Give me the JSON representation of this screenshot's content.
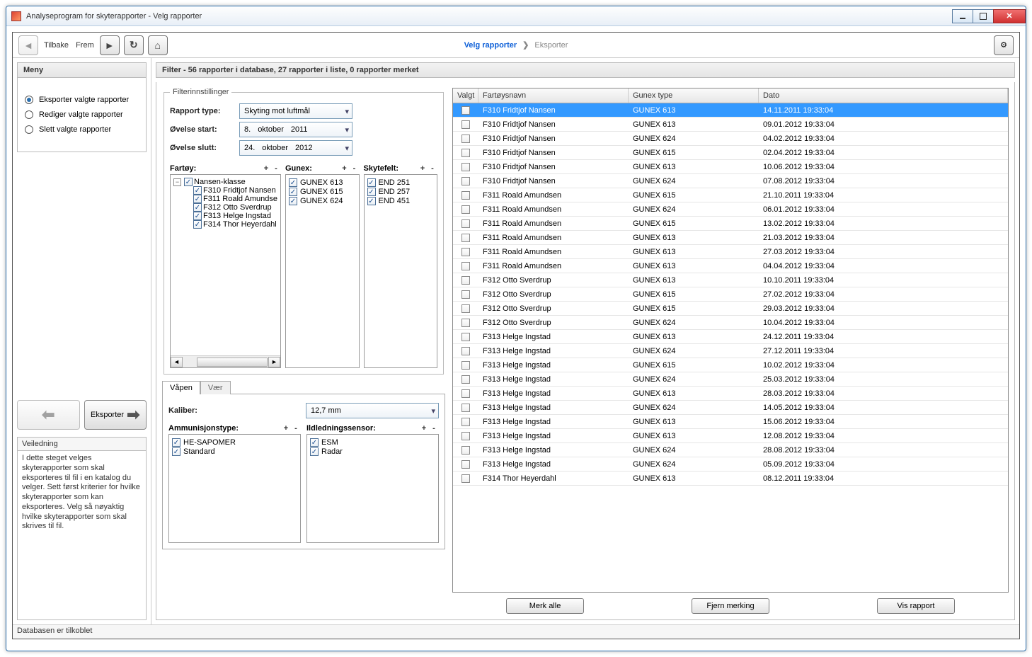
{
  "window_title": "Analyseprogram for skyterapporter - Velg rapporter",
  "toolbar": {
    "back": "Tilbake",
    "forward": "Frem"
  },
  "breadcrumb": {
    "step1": "Velg rapporter",
    "step2": "Eksporter"
  },
  "menu": {
    "title": "Meny",
    "options": [
      {
        "label": "Eksporter valgte rapporter",
        "checked": true
      },
      {
        "label": "Rediger valgte rapporter",
        "checked": false
      },
      {
        "label": "Slett valgte rapporter",
        "checked": false
      }
    ],
    "export_btn": "Eksporter"
  },
  "guide": {
    "title": "Veiledning",
    "text": "I dette steget velges skyterapporter som skal eksporteres til fil i en katalog du velger. Sett først kriterier for hvilke skyterapporter som kan eksporteres. Velg så nøyaktig hvilke skyterapporter som skal skrives til fil."
  },
  "filter": {
    "title": "Filter - 56 rapporter i database, 27 rapporter i liste, 0 rapporter merket",
    "legend": "Filterinnstillinger",
    "rows": {
      "type_label": "Rapport type:",
      "type_value": "Skyting mot luftmål",
      "start_label": "Øvelse start:",
      "start_d": "8.",
      "start_m": "oktober",
      "start_y": "2011",
      "slutt_label": "Øvelse slutt:",
      "slutt_d": "24.",
      "slutt_m": "oktober",
      "slutt_y": "2012"
    },
    "cols": {
      "fartoy": "Fartøy:",
      "gunex": "Gunex:",
      "skytefelt": "Skytefelt:"
    },
    "fartoy_tree": {
      "root": "Nansen-klasse",
      "children": [
        "F310 Fridtjof Nansen",
        "F311 Roald Amundse",
        "F312 Otto Sverdrup",
        "F313 Helge Ingstad",
        "F314 Thor Heyerdahl"
      ]
    },
    "gunex_items": [
      "GUNEX 613",
      "GUNEX 615",
      "GUNEX 624"
    ],
    "skytefelt_items": [
      "END 251",
      "END 257",
      "END 451"
    ],
    "tabs": {
      "vaapen": "Våpen",
      "vaer": "Vær"
    },
    "kaliber_label": "Kaliber:",
    "kaliber_value": "12,7 mm",
    "ammo_label": "Ammunisjonstype:",
    "ammo_items": [
      "HE-SAPOMER",
      "Standard"
    ],
    "sensor_label": "Ildledningssensor:",
    "sensor_items": [
      "ESM",
      "Radar"
    ]
  },
  "table": {
    "headers": {
      "valgt": "Valgt",
      "fartoy": "Fartøysnavn",
      "gunex": "Gunex type",
      "dato": "Dato"
    },
    "rows": [
      {
        "f": "F310 Fridtjof Nansen",
        "g": "GUNEX 613",
        "d": "14.11.2011 19:33:04",
        "sel": true
      },
      {
        "f": "F310 Fridtjof Nansen",
        "g": "GUNEX 613",
        "d": "09.01.2012 19:33:04"
      },
      {
        "f": "F310 Fridtjof Nansen",
        "g": "GUNEX 624",
        "d": "04.02.2012 19:33:04"
      },
      {
        "f": "F310 Fridtjof Nansen",
        "g": "GUNEX 615",
        "d": "02.04.2012 19:33:04"
      },
      {
        "f": "F310 Fridtjof Nansen",
        "g": "GUNEX 613",
        "d": "10.06.2012 19:33:04"
      },
      {
        "f": "F310 Fridtjof Nansen",
        "g": "GUNEX 624",
        "d": "07.08.2012 19:33:04"
      },
      {
        "f": "F311 Roald Amundsen",
        "g": "GUNEX 615",
        "d": "21.10.2011 19:33:04"
      },
      {
        "f": "F311 Roald Amundsen",
        "g": "GUNEX 624",
        "d": "06.01.2012 19:33:04"
      },
      {
        "f": "F311 Roald Amundsen",
        "g": "GUNEX 615",
        "d": "13.02.2012 19:33:04"
      },
      {
        "f": "F311 Roald Amundsen",
        "g": "GUNEX 613",
        "d": "21.03.2012 19:33:04"
      },
      {
        "f": "F311 Roald Amundsen",
        "g": "GUNEX 613",
        "d": "27.03.2012 19:33:04"
      },
      {
        "f": "F311 Roald Amundsen",
        "g": "GUNEX 613",
        "d": "04.04.2012 19:33:04"
      },
      {
        "f": "F312 Otto Sverdrup",
        "g": "GUNEX 613",
        "d": "10.10.2011 19:33:04"
      },
      {
        "f": "F312 Otto Sverdrup",
        "g": "GUNEX 615",
        "d": "27.02.2012 19:33:04"
      },
      {
        "f": "F312 Otto Sverdrup",
        "g": "GUNEX 615",
        "d": "29.03.2012 19:33:04"
      },
      {
        "f": "F312 Otto Sverdrup",
        "g": "GUNEX 624",
        "d": "10.04.2012 19:33:04"
      },
      {
        "f": "F313 Helge Ingstad",
        "g": "GUNEX 613",
        "d": "24.12.2011 19:33:04"
      },
      {
        "f": "F313 Helge Ingstad",
        "g": "GUNEX 624",
        "d": "27.12.2011 19:33:04"
      },
      {
        "f": "F313 Helge Ingstad",
        "g": "GUNEX 615",
        "d": "10.02.2012 19:33:04"
      },
      {
        "f": "F313 Helge Ingstad",
        "g": "GUNEX 624",
        "d": "25.03.2012 19:33:04"
      },
      {
        "f": "F313 Helge Ingstad",
        "g": "GUNEX 613",
        "d": "28.03.2012 19:33:04"
      },
      {
        "f": "F313 Helge Ingstad",
        "g": "GUNEX 624",
        "d": "14.05.2012 19:33:04"
      },
      {
        "f": "F313 Helge Ingstad",
        "g": "GUNEX 613",
        "d": "15.06.2012 19:33:04"
      },
      {
        "f": "F313 Helge Ingstad",
        "g": "GUNEX 613",
        "d": "12.08.2012 19:33:04"
      },
      {
        "f": "F313 Helge Ingstad",
        "g": "GUNEX 624",
        "d": "28.08.2012 19:33:04"
      },
      {
        "f": "F313 Helge Ingstad",
        "g": "GUNEX 624",
        "d": "05.09.2012 19:33:04"
      },
      {
        "f": "F314 Thor Heyerdahl",
        "g": "GUNEX 613",
        "d": "08.12.2011 19:33:04"
      }
    ],
    "buttons": {
      "all": "Merk alle",
      "clear": "Fjern merking",
      "show": "Vis rapport"
    }
  },
  "statusbar": "Databasen er tilkoblet"
}
